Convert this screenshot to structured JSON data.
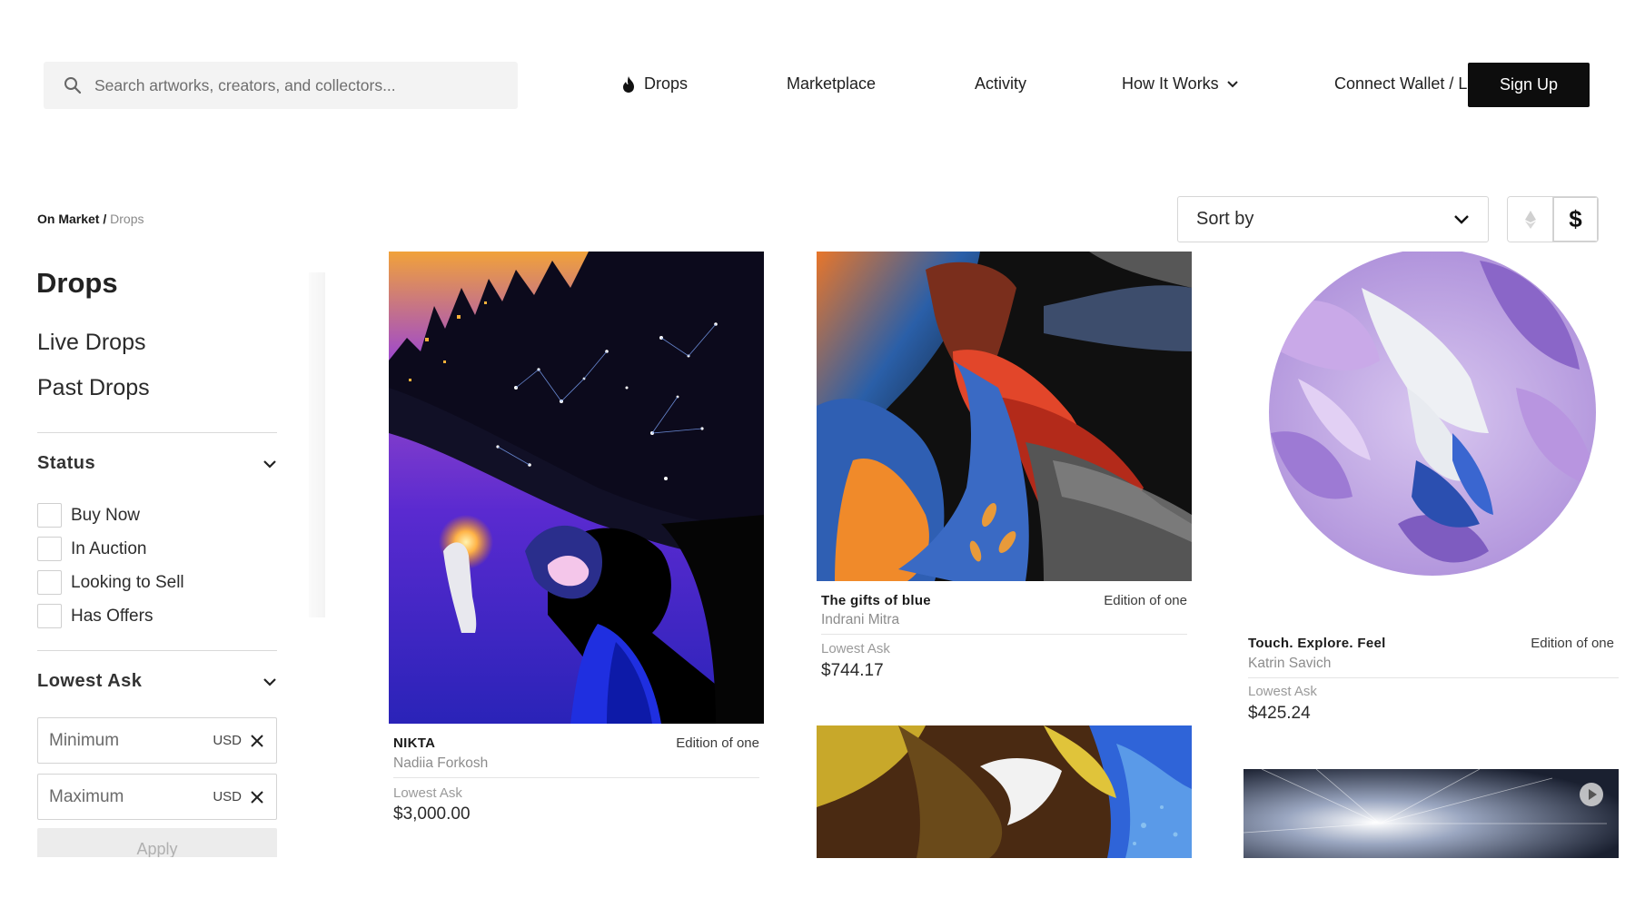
{
  "header": {
    "search_placeholder": "Search artworks, creators, and collectors...",
    "nav": {
      "drops": "Drops",
      "marketplace": "Marketplace",
      "activity": "Activity",
      "how_it_works": "How It Works",
      "connect": "Connect Wallet / Login"
    },
    "signup_label": "Sign Up"
  },
  "breadcrumb": {
    "current": "On Market",
    "separator": " / ",
    "trail": "Drops"
  },
  "sidebar": {
    "title": "Drops",
    "links": [
      "Live Drops",
      "Past Drops"
    ],
    "status": {
      "heading": "Status",
      "options": [
        "Buy Now",
        "In Auction",
        "Looking to Sell",
        "Has Offers"
      ]
    },
    "lowest_ask": {
      "heading": "Lowest Ask",
      "min_placeholder": "Minimum",
      "max_placeholder": "Maximum",
      "unit": "USD",
      "apply_label": "Apply"
    }
  },
  "controls": {
    "sort_label": "Sort by",
    "currency_selected": "USD",
    "usd_symbol": "$"
  },
  "cards": [
    {
      "title": "NIKTA",
      "artist": "Nadiia Forkosh",
      "edition": "Edition of one",
      "ask_label": "Lowest Ask",
      "price": "$3,000.00"
    },
    {
      "title": "The gifts of blue",
      "artist": "Indrani Mitra",
      "edition": "Edition of one",
      "ask_label": "Lowest Ask",
      "price": "$744.17"
    },
    {
      "title": "Touch. Explore. Feel",
      "artist": "Katrin Savich",
      "edition": "Edition of one",
      "ask_label": "Lowest Ask",
      "price": "$425.24"
    }
  ],
  "colors": {
    "signup_bg": "#0d0d0d",
    "search_bg": "#f3f3f3",
    "divider": "#d9d9d9"
  },
  "icons": [
    "search-icon",
    "flame-icon",
    "chevron-down-icon",
    "close-icon",
    "ethereum-icon",
    "play-icon"
  ]
}
